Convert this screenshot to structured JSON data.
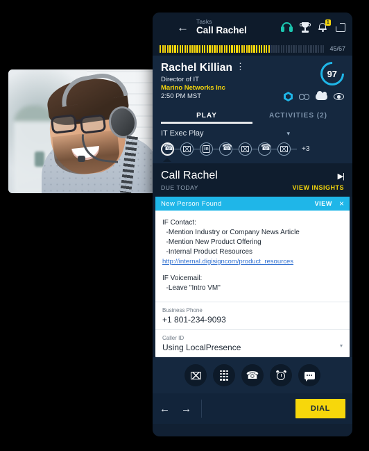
{
  "topbar": {
    "menu_icon": "hamburger-icon",
    "back_icon": "back-arrow-icon",
    "breadcrumb": "Tasks",
    "title": "Call Rachel",
    "headset_icon": "headset-icon",
    "trophy_icon": "trophy-icon",
    "bell_icon": "bell-icon",
    "bell_badge": "1",
    "window_icon": "window-icon"
  },
  "progress": {
    "label": "45/67",
    "completed": 45,
    "total": 67
  },
  "contact": {
    "name": "Rachel Killian",
    "kebab": "⋮",
    "title": "Director of IT",
    "company": "Marino Networks Inc",
    "local_time": "2:50 PM MST",
    "score": "97",
    "icons": [
      "cube-icon",
      "link-icon",
      "salesforce-cloud-icon",
      "eye-icon"
    ]
  },
  "tabs": [
    {
      "label": "PLAY",
      "active": true
    },
    {
      "label": "ACTIVITIES (2)",
      "active": false
    }
  ],
  "play": {
    "name": "IT Exec Play",
    "caret": "▾",
    "steps": [
      "phone",
      "mail",
      "linkedin",
      "phone",
      "mail",
      "phone",
      "mail"
    ],
    "linkedin_glyph": "in",
    "more": "+3"
  },
  "task": {
    "name": "Call Rachel",
    "skip_icon": "skip-next-icon",
    "due": "DUE TODAY",
    "insights": "VIEW INSIGHTS"
  },
  "alert": {
    "title": "New Person Found",
    "view": "VIEW",
    "close": "×"
  },
  "script": {
    "body": "IF Contact:\n  -Mention Industry or Company News Article\n  -Mention New Product Offering\n  -Internal Product Resources",
    "link": "http://internal.digisigncom/product_resources",
    "body2": "IF Voicemail:\n  -Leave \"Intro VM\""
  },
  "fields": [
    {
      "label": "Business Phone",
      "value": "+1 801-234-9093",
      "dropdown": false
    },
    {
      "label": "Caller ID",
      "value": "Using LocalPresence",
      "dropdown": true,
      "caret": "▾"
    }
  ],
  "quick_actions": [
    "email-icon",
    "dialpad-icon",
    "call-icon",
    "snooze-alarm-icon",
    "sms-icon"
  ],
  "footer": {
    "prev": "←",
    "next": "→",
    "dial": "DIAL"
  },
  "photo": {
    "alt": "smiling-man-with-headset"
  },
  "colors": {
    "accent_yellow": "#f7d70b",
    "accent_cyan": "#1fb6e8",
    "panel_bg": "#112033",
    "card_bg": "#ffffff"
  }
}
